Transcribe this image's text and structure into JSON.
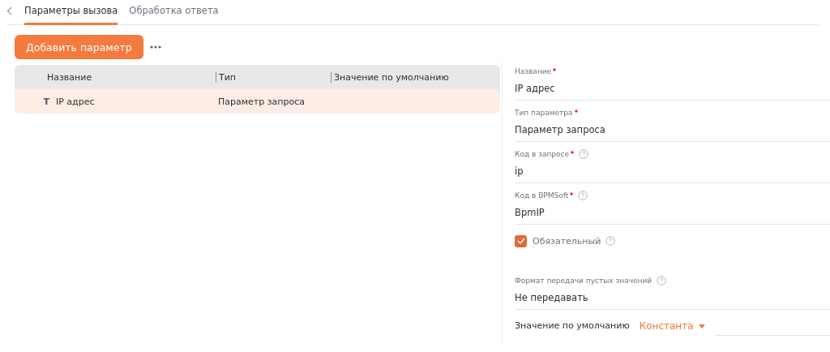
{
  "tabs": [
    {
      "label": "Параметры вызова",
      "selected": true
    },
    {
      "label": "Обработка ответа",
      "selected": false
    }
  ],
  "add_button": "Добавить параметр",
  "table": {
    "columns": [
      "Название",
      "Тип",
      "Значение по умолчанию"
    ],
    "rows": [
      {
        "type_icon": "T",
        "name": "IP адрес",
        "type": "Параметр запроса",
        "selected": true
      }
    ]
  },
  "form": [
    {
      "kind": "field",
      "label": "Название",
      "required": true,
      "help": false,
      "value": "IP адрес"
    },
    {
      "kind": "field",
      "label": "Тип параметра",
      "required": true,
      "help": false,
      "value": "Параметр запроса"
    },
    {
      "kind": "field",
      "label": "Код в запросе",
      "required": true,
      "help": true,
      "value": "ip"
    },
    {
      "kind": "field",
      "label": "Код в BPMSoft",
      "required": true,
      "help": true,
      "value": "BpmIP"
    },
    {
      "kind": "checkbox",
      "label": "Обязательный",
      "checked": true,
      "help": true
    },
    {
      "kind": "field",
      "label": "Формат передачи пустых значений",
      "required": false,
      "help": true,
      "value": "Не передавать"
    },
    {
      "kind": "default",
      "label": "Значение по умолчанию",
      "mode": "Константа"
    }
  ]
}
